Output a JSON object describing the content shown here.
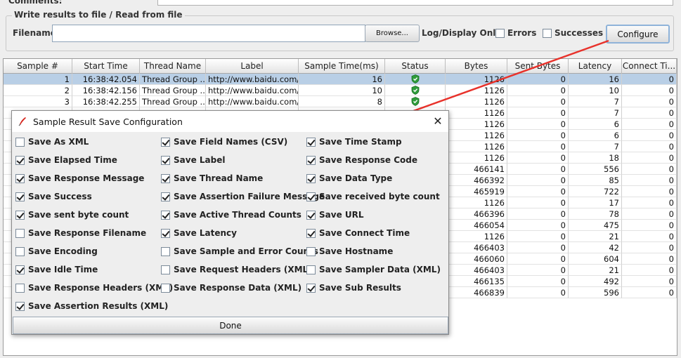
{
  "top": {
    "comment_label": "Comments:"
  },
  "file_panel": {
    "legend": "Write results to file / Read from file",
    "filename_label": "Filename",
    "filename_value": "",
    "browse_label": "Browse...",
    "log_display_label": "Log/Display Only:",
    "errors_label": "Errors",
    "successes_label": "Successes",
    "configure_label": "Configure"
  },
  "table": {
    "columns": [
      "Sample #",
      "Start Time",
      "Thread Name",
      "Label",
      "Sample Time(ms)",
      "Status",
      "Bytes",
      "Sent Bytes",
      "Latency",
      "Connect Ti..."
    ],
    "rows": [
      {
        "n": "1",
        "start": "16:38:42.054",
        "thread": "Thread Group ...",
        "label": "http://www.baidu.com/",
        "time": "16",
        "bytes": "1126",
        "sent": "0",
        "latency": "16",
        "connect": "0"
      },
      {
        "n": "2",
        "start": "16:38:42.156",
        "thread": "Thread Group ...",
        "label": "http://www.baidu.com/",
        "time": "10",
        "bytes": "1126",
        "sent": "0",
        "latency": "10",
        "connect": "0"
      },
      {
        "n": "3",
        "start": "16:38:42.255",
        "thread": "Thread Group ...",
        "label": "http://www.baidu.com/",
        "time": "8",
        "bytes": "1126",
        "sent": "0",
        "latency": "7",
        "connect": "0"
      },
      {
        "n": "",
        "start": "",
        "thread": "",
        "label": "",
        "time": "",
        "bytes": "1126",
        "sent": "0",
        "latency": "7",
        "connect": "0"
      },
      {
        "n": "",
        "start": "",
        "thread": "",
        "label": "",
        "time": "",
        "bytes": "1126",
        "sent": "0",
        "latency": "6",
        "connect": "0"
      },
      {
        "n": "",
        "start": "",
        "thread": "",
        "label": "",
        "time": "",
        "bytes": "1126",
        "sent": "0",
        "latency": "6",
        "connect": "0"
      },
      {
        "n": "",
        "start": "",
        "thread": "",
        "label": "",
        "time": "",
        "bytes": "1126",
        "sent": "0",
        "latency": "7",
        "connect": "0"
      },
      {
        "n": "",
        "start": "",
        "thread": "",
        "label": "",
        "time": "",
        "bytes": "1126",
        "sent": "0",
        "latency": "18",
        "connect": "0"
      },
      {
        "n": "",
        "start": "",
        "thread": "",
        "label": "",
        "time": "",
        "bytes": "466141",
        "sent": "0",
        "latency": "556",
        "connect": "0"
      },
      {
        "n": "",
        "start": "",
        "thread": "",
        "label": "",
        "time": "",
        "bytes": "466392",
        "sent": "0",
        "latency": "85",
        "connect": "0"
      },
      {
        "n": "",
        "start": "",
        "thread": "",
        "label": "",
        "time": "",
        "bytes": "465919",
        "sent": "0",
        "latency": "722",
        "connect": "0"
      },
      {
        "n": "",
        "start": "",
        "thread": "",
        "label": "",
        "time": "",
        "bytes": "1126",
        "sent": "0",
        "latency": "17",
        "connect": "0"
      },
      {
        "n": "",
        "start": "",
        "thread": "",
        "label": "",
        "time": "",
        "bytes": "466396",
        "sent": "0",
        "latency": "78",
        "connect": "0"
      },
      {
        "n": "",
        "start": "",
        "thread": "",
        "label": "",
        "time": "",
        "bytes": "466054",
        "sent": "0",
        "latency": "475",
        "connect": "0"
      },
      {
        "n": "",
        "start": "",
        "thread": "",
        "label": "",
        "time": "",
        "bytes": "1126",
        "sent": "0",
        "latency": "21",
        "connect": "0"
      },
      {
        "n": "",
        "start": "",
        "thread": "",
        "label": "",
        "time": "",
        "bytes": "466403",
        "sent": "0",
        "latency": "42",
        "connect": "0"
      },
      {
        "n": "",
        "start": "",
        "thread": "",
        "label": "",
        "time": "",
        "bytes": "466060",
        "sent": "0",
        "latency": "604",
        "connect": "0"
      },
      {
        "n": "",
        "start": "",
        "thread": "",
        "label": "",
        "time": "",
        "bytes": "466403",
        "sent": "0",
        "latency": "21",
        "connect": "0"
      },
      {
        "n": "",
        "start": "",
        "thread": "",
        "label": "",
        "time": "",
        "bytes": "466135",
        "sent": "0",
        "latency": "492",
        "connect": "0"
      },
      {
        "n": "",
        "start": "",
        "thread": "",
        "label": "",
        "time": "",
        "bytes": "466839",
        "sent": "0",
        "latency": "596",
        "connect": "0"
      }
    ]
  },
  "dialog": {
    "title": "Sample Result Save Configuration",
    "done_label": "Done",
    "options": [
      {
        "label": "Save As XML",
        "checked": false
      },
      {
        "label": "Save Field Names (CSV)",
        "checked": true
      },
      {
        "label": "Save Time Stamp",
        "checked": true
      },
      {
        "label": "Save Elapsed Time",
        "checked": true
      },
      {
        "label": "Save Label",
        "checked": true
      },
      {
        "label": "Save Response Code",
        "checked": true
      },
      {
        "label": "Save Response Message",
        "checked": true
      },
      {
        "label": "Save Thread Name",
        "checked": true
      },
      {
        "label": "Save Data Type",
        "checked": true
      },
      {
        "label": "Save Success",
        "checked": true
      },
      {
        "label": "Save Assertion Failure Message",
        "checked": true
      },
      {
        "label": "Save received byte count",
        "checked": true
      },
      {
        "label": "Save sent byte count",
        "checked": true
      },
      {
        "label": "Save Active Thread Counts",
        "checked": true
      },
      {
        "label": "Save URL",
        "checked": true
      },
      {
        "label": "Save Response Filename",
        "checked": false
      },
      {
        "label": "Save Latency",
        "checked": true
      },
      {
        "label": "Save Connect Time",
        "checked": true
      },
      {
        "label": "Save Encoding",
        "checked": false
      },
      {
        "label": "Save Sample and Error Counts",
        "checked": false
      },
      {
        "label": "Save Hostname",
        "checked": false
      },
      {
        "label": "Save Idle Time",
        "checked": true
      },
      {
        "label": "Save Request Headers (XML)",
        "checked": false
      },
      {
        "label": "Save Sampler Data (XML)",
        "checked": false
      },
      {
        "label": "Save Response Headers (XML)",
        "checked": false
      },
      {
        "label": "Save Response Data (XML)",
        "checked": false
      },
      {
        "label": "Save Sub Results",
        "checked": true
      },
      {
        "label": "Save Assertion Results (XML)",
        "checked": true
      }
    ]
  },
  "colors": {
    "selected_row": "#b9cfe6",
    "status_ok": "#2e9c3a",
    "annotation_arrow": "#e8322b"
  }
}
